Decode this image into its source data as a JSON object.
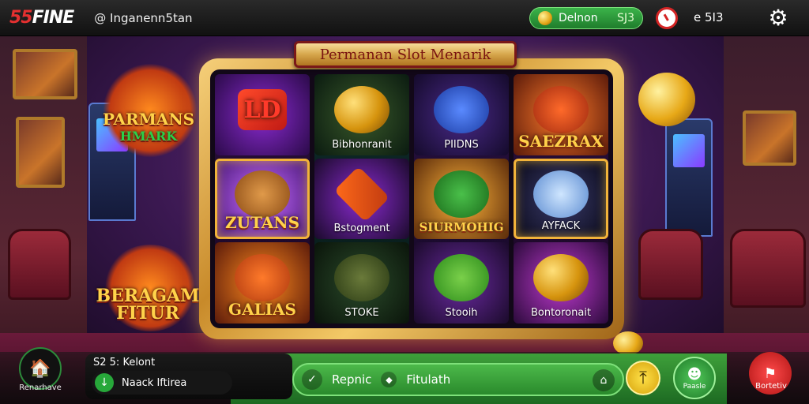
{
  "topbar": {
    "logo_num": "55",
    "logo_txt": "FINE",
    "user": "@ Inganenn5tan",
    "balance_label": "Delnon",
    "balance_amount": "SJ3",
    "bet_label": "e 5I3"
  },
  "title": "Permanan Slot Menarik",
  "reels": [
    [
      {
        "label": "",
        "style": "big-logo"
      },
      {
        "label": "ZUTANS",
        "style": "big"
      },
      {
        "label": "GALIAS",
        "style": "big"
      }
    ],
    [
      {
        "label": "Bibhonranit",
        "style": "pill"
      },
      {
        "label": "Bstogment",
        "style": "pill"
      },
      {
        "label": "STOKE",
        "style": "pill"
      }
    ],
    [
      {
        "label": "PIIDNS",
        "style": "pill"
      },
      {
        "label": "SIURMOHIG",
        "style": "big"
      },
      {
        "label": "Stooih",
        "style": "pill"
      }
    ],
    [
      {
        "label": "SAEZRAX",
        "style": "big"
      },
      {
        "label": "AYFACK",
        "style": "pill"
      },
      {
        "label": "Bontoronait",
        "style": "pill"
      }
    ]
  ],
  "promos": {
    "top": {
      "line1": "PARMANS",
      "line2": "HMARK"
    },
    "bottom": {
      "line1": "BERAGAM",
      "line2": "FITUR"
    }
  },
  "bottom": {
    "home_label": "Renarhave",
    "info_top": "S2 5: Kelont",
    "info_pill": "Naack Iftirea",
    "action_1": "Repnic",
    "action_2": "Fitulath",
    "profile_label": "Paasle",
    "red_label": "Bortetiv"
  },
  "colors": {
    "accent_green": "#2a8a2c",
    "gold": "#d6a64b",
    "logo_red": "#e53030"
  }
}
